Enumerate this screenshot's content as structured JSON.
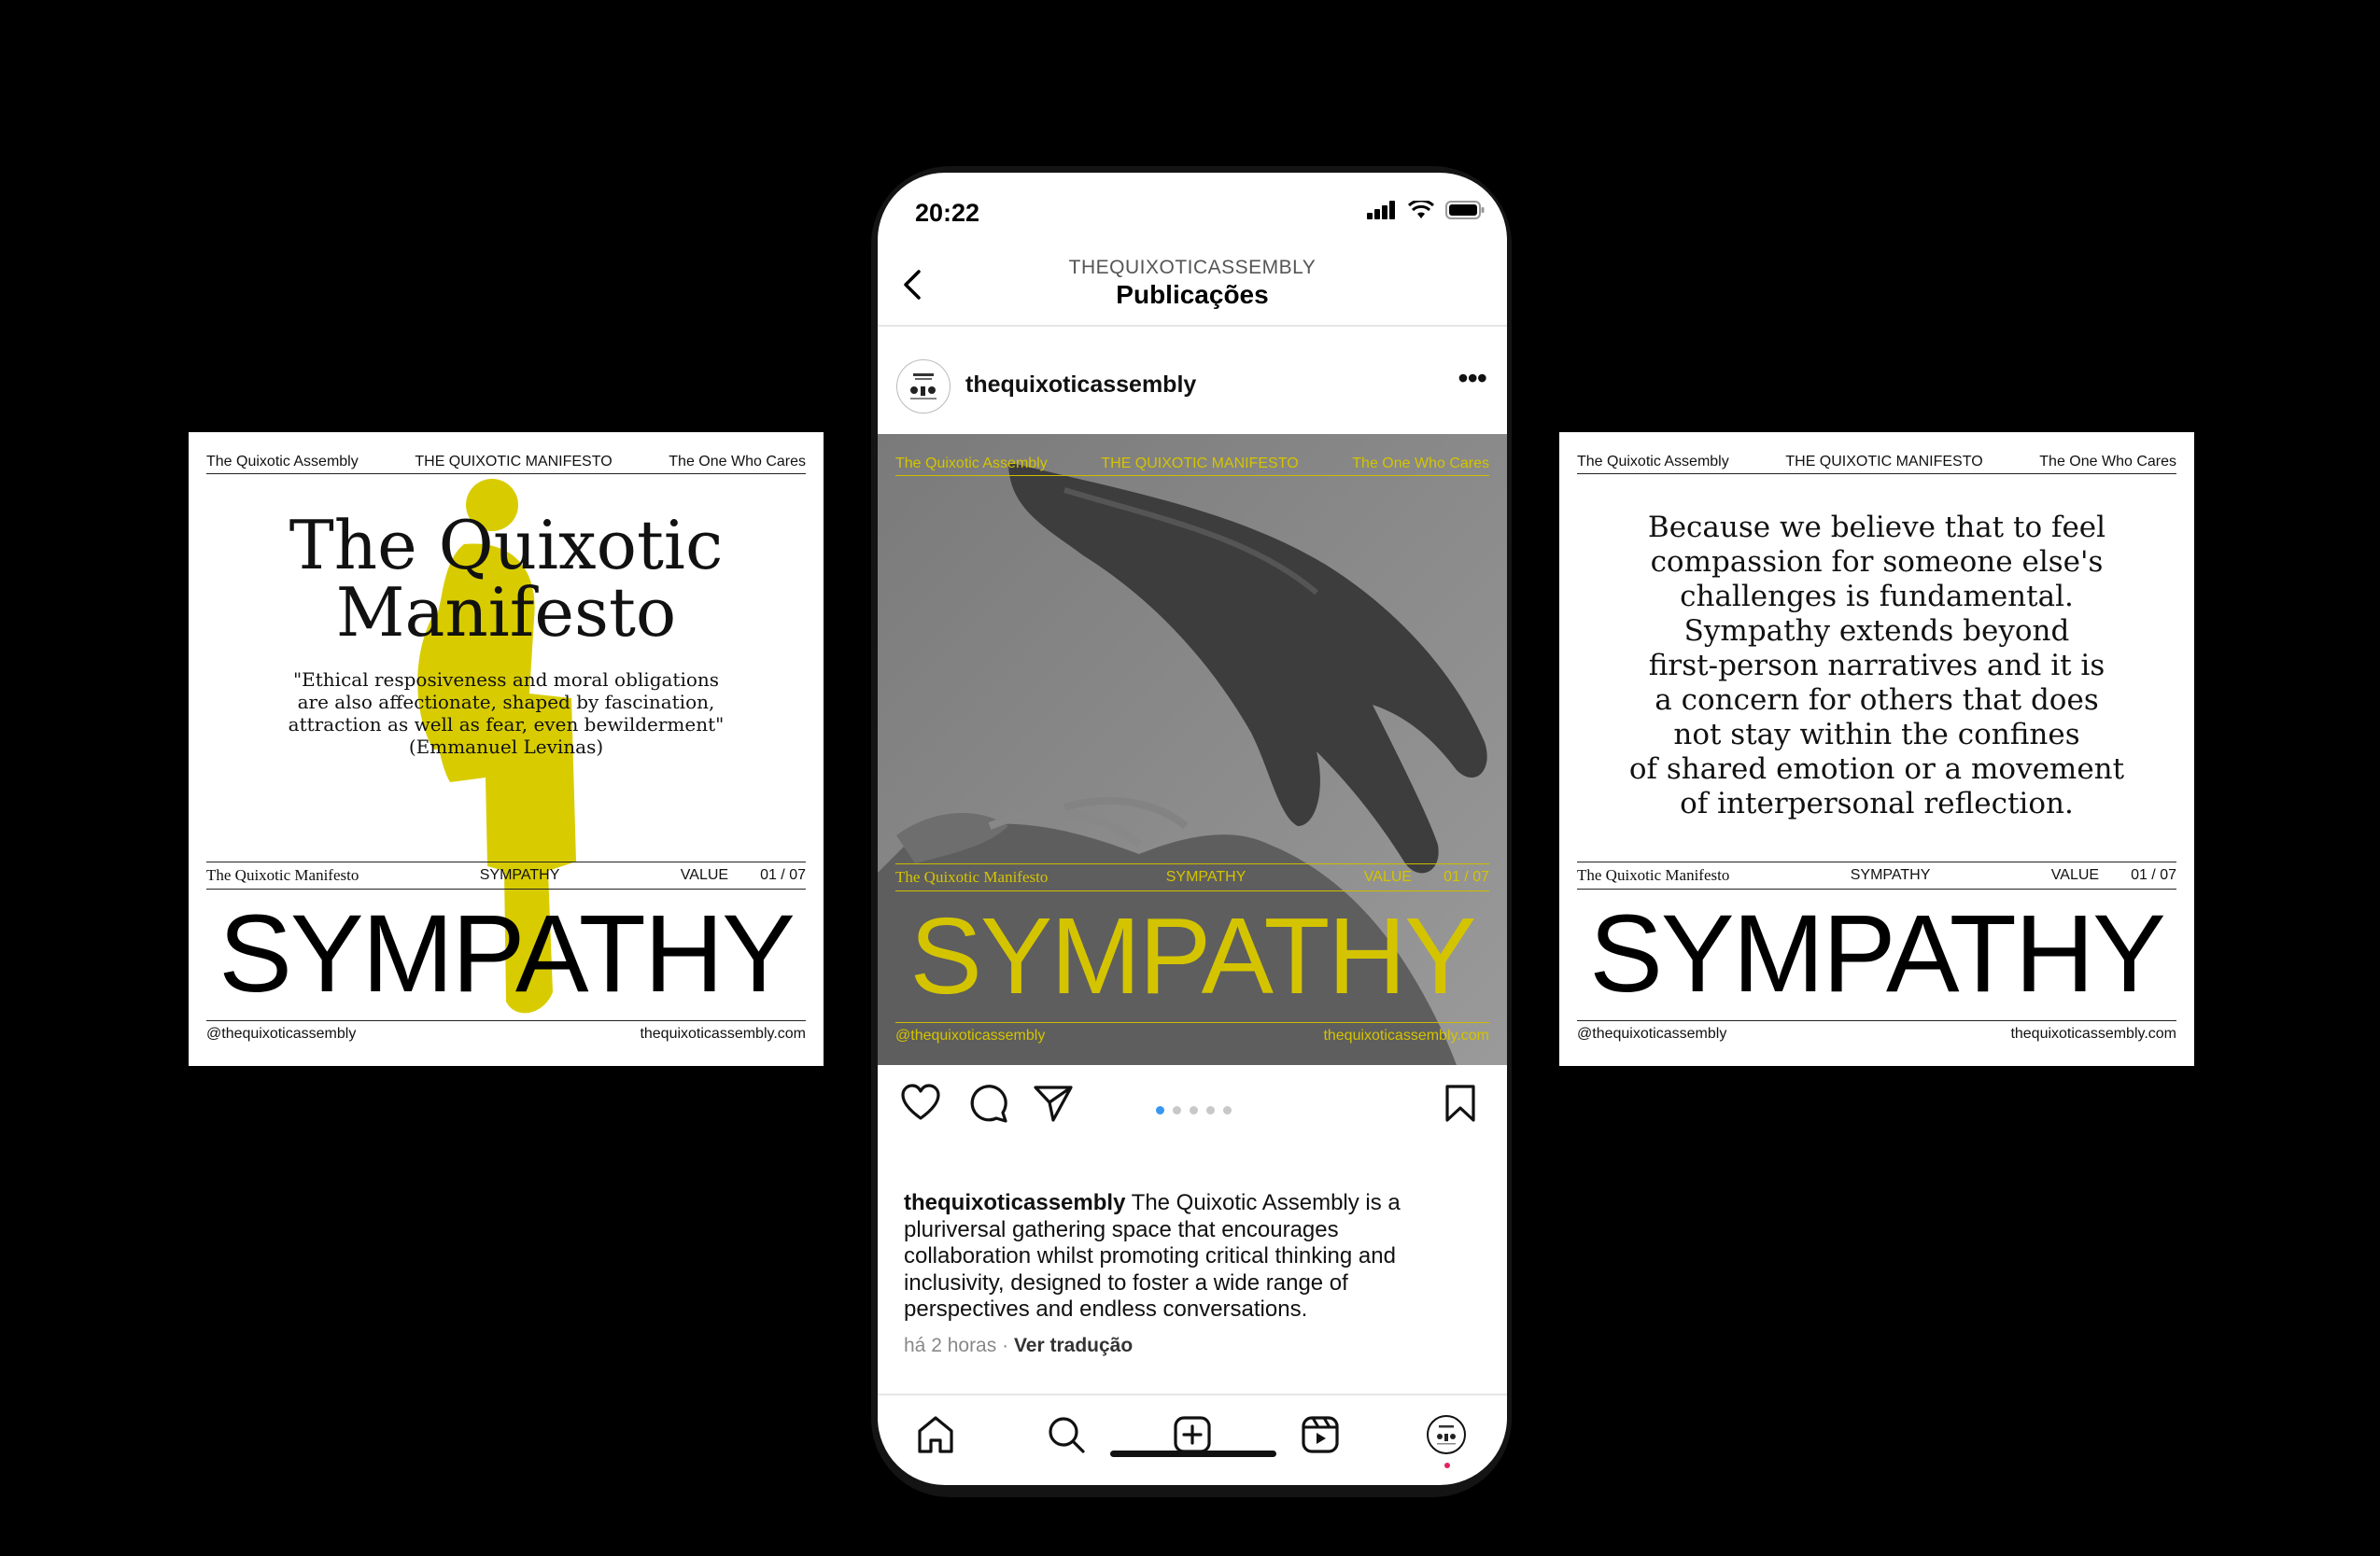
{
  "left_card": {
    "header": [
      "The Quixotic Assembly",
      "THE QUIXOTIC MANIFESTO",
      "The One Who Cares"
    ],
    "title_line1": "The Quixotic",
    "title_line2": "Manifesto",
    "quote_line1": "\"Ethical resposiveness and moral obligations",
    "quote_line2": "are also affectionate, shaped by fascination,",
    "quote_line3": "attraction as well as fear, even bewilderment\"",
    "quote_line4": "(Emmanuel Levinas)",
    "meta_left": "The Quixotic Manifesto",
    "meta_center": "SYMPATHY",
    "meta_value": "VALUE",
    "meta_page": "01 / 07",
    "big_word": "SYMPATHY",
    "footer_left": "@thequixoticassembly",
    "footer_right": "thequixoticassembly.com"
  },
  "right_card": {
    "header": [
      "The Quixotic Assembly",
      "THE QUIXOTIC MANIFESTO",
      "The One Who Cares"
    ],
    "lines": [
      "Because we believe that to feel",
      "compassion for someone else's",
      "challenges is fundamental.",
      "Sympathy extends beyond",
      "first-person narratives and it is",
      "a concern for others that does",
      "not stay within the confines",
      "of shared emotion or a movement",
      "of interpersonal reflection."
    ],
    "meta_left": "The Quixotic Manifesto",
    "meta_center": "SYMPATHY",
    "meta_value": "VALUE",
    "meta_page": "01 / 07",
    "big_word": "SYMPATHY",
    "footer_left": "@thequixoticassembly",
    "footer_right": "thequixoticassembly.com"
  },
  "phone": {
    "status": {
      "time": "20:22"
    },
    "nav": {
      "username": "THEQUIXOTICASSEMBLY",
      "title": "Publicações"
    },
    "post": {
      "username": "thequixoticassembly",
      "more": "•••",
      "image": {
        "header": [
          "The Quixotic Assembly",
          "THE QUIXOTIC MANIFESTO",
          "The One Who Cares"
        ],
        "meta_left": "The Quixotic Manifesto",
        "meta_center": "SYMPATHY",
        "meta_value": "VALUE",
        "meta_page": "01 / 07",
        "big_word": "SYMPATHY",
        "footer_left": "@thequixoticassembly",
        "footer_right": "thequixoticassembly.com"
      },
      "carousel": {
        "count": 5,
        "active": 1
      },
      "caption_user": "thequixoticassembly",
      "caption_text": "The Quixotic Assembly is a pluriversal gathering space that encourages collaboration whilst promoting critical thinking and inclusivity, designed to foster a wide range of perspectives and endless conversations.",
      "time_ago": "há 2 horas",
      "separator": "·",
      "translate": "Ver tradução"
    },
    "tabs": [
      "home-icon",
      "search-icon",
      "create-icon",
      "reels-icon",
      "profile-avatar"
    ]
  },
  "colors": {
    "accent_yellow": "#d4c400",
    "carousel_active": "#3897f0",
    "background": "#000000"
  }
}
